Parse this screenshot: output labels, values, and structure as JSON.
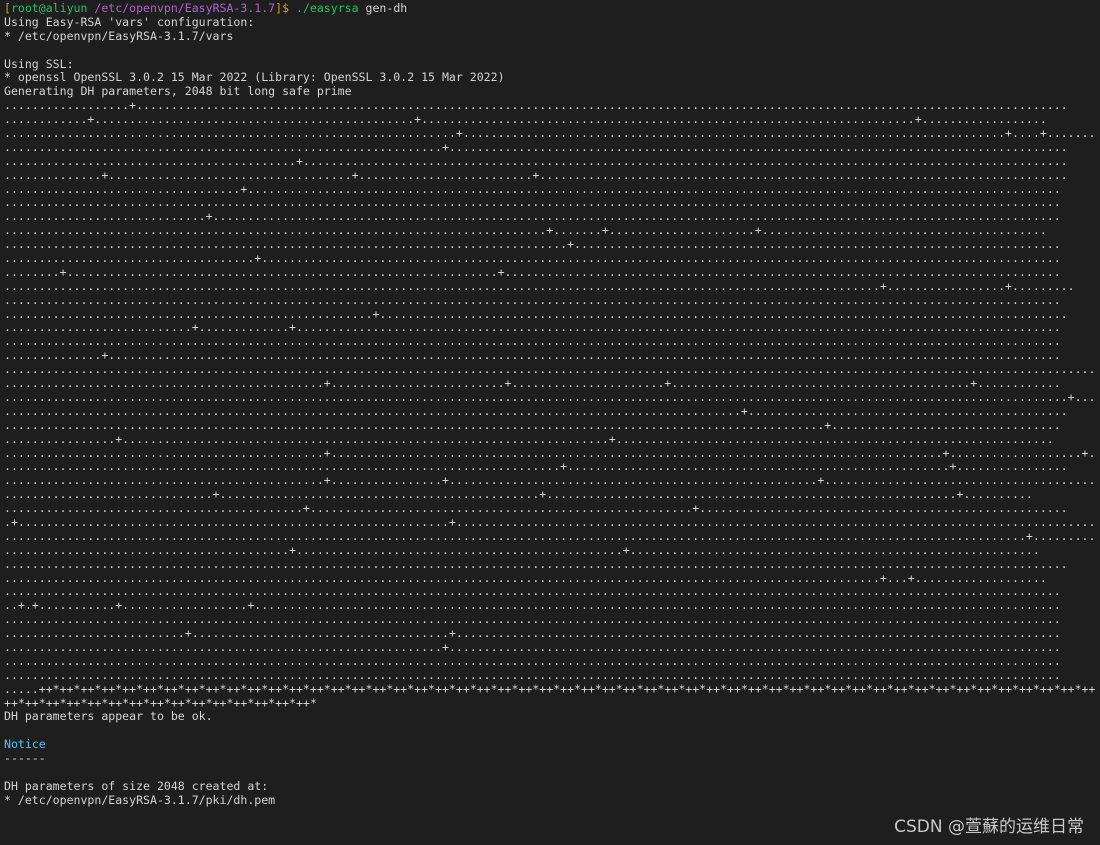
{
  "prompt": {
    "open_bracket": "[",
    "user": "root@aliyun",
    "path": "/etc/openvpn/EasyRSA-3.1.7",
    "close_bracket": "]$ ",
    "command": "./easyrsa",
    "args": " gen-dh"
  },
  "intro_lines": [
    "Using Easy-RSA 'vars' configuration:",
    "* /etc/openvpn/EasyRSA-3.1.7/vars",
    "",
    "Using SSL:",
    "* openssl OpenSSL 3.0.2 15 Mar 2022 (Library: OpenSSL 3.0.2 15 Mar 2022)",
    "Generating DH parameters, 2048 bit long safe prime"
  ],
  "progress_lines": [
    "..................+......................................................................................................................................",
    "............+..............................................+.......................................................................+..................",
    ".................................................................+..............................................................................+....+.......",
    "...............................................................+.........................................................................................",
    "..........................................+..............................................................................................................",
    "..............+...................................+.........................+............................................................................",
    "..................................+.....................................................................................................................",
    "........................................................................................................................................................",
    ".............................+..........................................................................................................................",
    "..............................................................................+.......+.....................+.........................................",
    ".................................................................................+......................................................................",
    "....................................+...................................................................................................................",
    "........+..............................................................+................................................................................",
    "..............................................................................................................................+.................+.........",
    "........................................................................................................................................................",
    ".....................................................+...................................................................................................",
    "...........................+.............+..............................................................................................................",
    "........................................................................................................................................................",
    "..............+.........................................................................................................................................",
    "................................................................................................................................................................+.",
    "..............................................+.........................+......................+...........................................+............",
    ".........................................................................................................................................................+......",
    "..........................................................................................................+..............................................",
    "......................................................................................................................+.................................",
    "................+......................................................................+...............................................................",
    "..............................................+........................................................................................+...................+......",
    "................................................................................+.......................................................+................",
    "..............................................+................+.....................................................+.......................................",
    "..............................+..............................................+...........................................................+..........",
    "...........................................+.......................................................+.....................................................",
    ".+..............................................................+..............................................................................................+.....",
    "...................................................................................................................................................+..........",
    ".........................................+...............................................+...........................................................",
    ".........................................................................................................................................................",
    "..............................................................................................................................+...+...................",
    "........................................................................................................................................................",
    "..+.+...........+..................+....................................................................................................................",
    "........................................................................................................................................................",
    "..........................+.....................................+.......................................................................................",
    "...............................................................+........................................................................................",
    "........................................................................................................................................................",
    "........................................................................................................................................................",
    ".....++*++*++*++*++*++*++*++*++*++*++*++*++*++*++*++*++*++*++*++*++*++*++*++*++*++*++*++*++*++*++*++*++*++*++*++*++*++*++*++*++*++*++*++*++*++*++*++*++*++*++*",
    "++*++*++*++*++*++*++*++*++*++*++*++*++*++*++*"
  ],
  "outro_lines": [
    "DH parameters appear to be ok.",
    "",
    "Notice",
    "------",
    "",
    "DH parameters of size 2048 created at:",
    "* /etc/openvpn/EasyRSA-3.1.7/pki/dh.pem"
  ],
  "watermark": "CSDN @萱蘇的运维日常"
}
